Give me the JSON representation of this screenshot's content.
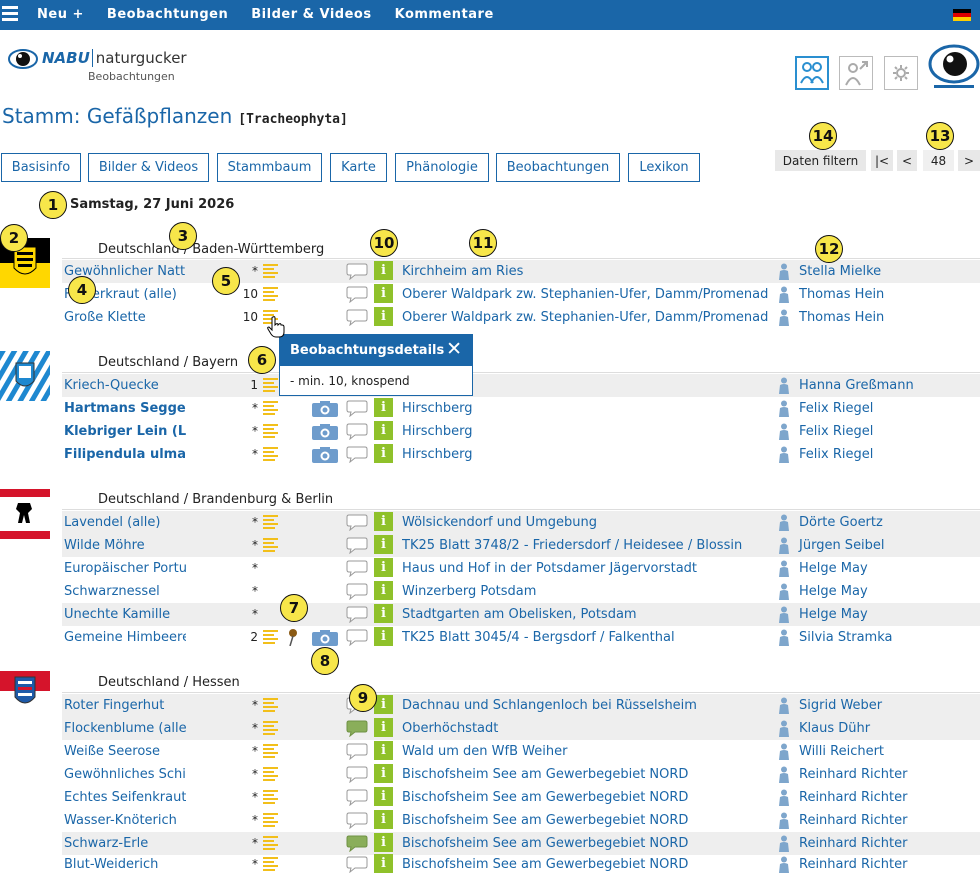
{
  "topnav": {
    "items": [
      "Neu +",
      "Bebachtungen",
      "Bilder & Videos",
      "Kommentare"
    ]
  },
  "logo": {
    "brand": "NABU",
    "product": "naturgucker",
    "sub": "Beobachtungen"
  },
  "title": {
    "main": "Stamm: Gefäßpflanzen",
    "scientific": "[Tracheophyta]"
  },
  "tabs": [
    "Basisinfo",
    "Bilder & Videos",
    "Stammbaum",
    "Karte",
    "Phänologie",
    "Beobachtungen",
    "Lexikon"
  ],
  "pager": {
    "filter": "Daten filtern",
    "first": "|<",
    "prev": "<",
    "page": "48",
    "next": ">"
  },
  "date": "Samstag, 27 Juni 2026",
  "popup": {
    "title": "Beobachtungsdetails",
    "close": "✕",
    "body": "-  min. 10, knospend"
  },
  "markers": [
    "1",
    "2",
    "3",
    "4",
    "5",
    "6",
    "7",
    "8",
    "9",
    "10",
    "11",
    "12",
    "13",
    "14"
  ],
  "groups": [
    {
      "region": "Deutschland / Baden-Württemberg",
      "rows": [
        {
          "name": "Gewöhnlicher Natt",
          "count": "*",
          "loc": "Kirchheim am Ries",
          "user": "Stella Mielke",
          "shade": true
        },
        {
          "name": "Färberkraut (alle)",
          "count": "10",
          "loc": "Oberer Waldpark zw. Stephanien-Ufer, Damm/Promenad",
          "user": "Thomas Hein",
          "shade": false
        },
        {
          "name": "Große Klette",
          "count": "10",
          "loc": "Oberer Waldpark zw. Stephanien-Ufer, Damm/Promenad",
          "user": "Thomas Hein",
          "shade": false
        }
      ]
    },
    {
      "region": "Deutschland / Bayern",
      "rows": [
        {
          "name": "Kriech-Quecke",
          "count": "1",
          "loc": "",
          "user": "Hanna Greßmann",
          "shade": true
        },
        {
          "name": "Hartmans Segge",
          "count": "*",
          "loc": "Hirschberg",
          "user": "Felix Riegel",
          "shade": false,
          "bold": true
        },
        {
          "name": "Klebriger Lein (L",
          "count": "*",
          "loc": "Hirschberg",
          "user": "Felix Riegel",
          "shade": false,
          "bold": true
        },
        {
          "name": "Filipendula ulma",
          "count": "*",
          "loc": "Hirschberg",
          "user": "Felix Riegel",
          "shade": false,
          "bold": true
        }
      ]
    },
    {
      "region": "Deutschland / Brandenburg & Berlin",
      "rows": [
        {
          "name": "Lavendel (alle)",
          "count": "*",
          "loc": "Wölsickendorf und Umgebung",
          "user": "Dörte Goertz",
          "shade": true
        },
        {
          "name": "Wilde Möhre",
          "count": "*",
          "loc": "TK25 Blatt 3748/2 - Friedersdorf / Heidesee / Blossin",
          "user": "Jürgen Seibel",
          "shade": true
        },
        {
          "name": "Europäischer Portu",
          "count": "*",
          "loc": "Haus und Hof in der Potsdamer Jägervorstadt",
          "user": "Helge May",
          "shade": false
        },
        {
          "name": "Schwarznessel",
          "count": "*",
          "loc": "Winzerberg Potsdam",
          "user": "Helge May",
          "shade": false
        },
        {
          "name": "Unechte Kamille",
          "count": "*",
          "loc": "Stadtgarten am Obelisken, Potsdam",
          "user": "Helge May",
          "shade": true
        },
        {
          "name": "Gemeine Himbeere",
          "count": "2",
          "loc": "TK25 Blatt 3045/4 - Bergsdorf / Falkenthal",
          "user": "Silvia Stramka",
          "shade": false
        }
      ]
    },
    {
      "region": "Deutschland / Hessen",
      "rows": [
        {
          "name": "Roter Fingerhut",
          "count": "*",
          "loc": "Dachnau und Schlangenloch bei Rüsselsheim",
          "user": "Sigrid Weber",
          "shade": true
        },
        {
          "name": "Flockenblume (alle",
          "count": "*",
          "loc": "Oberhöchstadt",
          "user": "Klaus Dühr",
          "shade": true
        },
        {
          "name": "Weiße Seerose",
          "count": "*",
          "loc": "Wald um den WfB Weiher",
          "user": "Willi Reichert",
          "shade": false
        },
        {
          "name": "Gewöhnliches Schi",
          "count": "*",
          "loc": "Bischofsheim See am Gewerbegebiet NORD",
          "user": "Reinhard Richter",
          "shade": false
        },
        {
          "name": "Echtes Seifenkraut",
          "count": "*",
          "loc": "Bischofsheim See am Gewerbegebiet NORD",
          "user": "Reinhard Richter",
          "shade": false
        },
        {
          "name": "Wasser-Knöterich",
          "count": "*",
          "loc": "Bischofsheim See am Gewerbegebiet NORD",
          "user": "Reinhard Richter",
          "shade": false
        },
        {
          "name": "Schwarz-Erle",
          "count": "*",
          "loc": "Bischofsheim See am Gewerbegebiet NORD",
          "user": "Reinhard Richter",
          "shade": false
        },
        {
          "name": "Blut-Weiderich",
          "count": "*",
          "loc": "Bischofsheim See am Gewerbegebiet NORD",
          "user": "Reinhard Richter",
          "shade": false
        }
      ]
    }
  ]
}
